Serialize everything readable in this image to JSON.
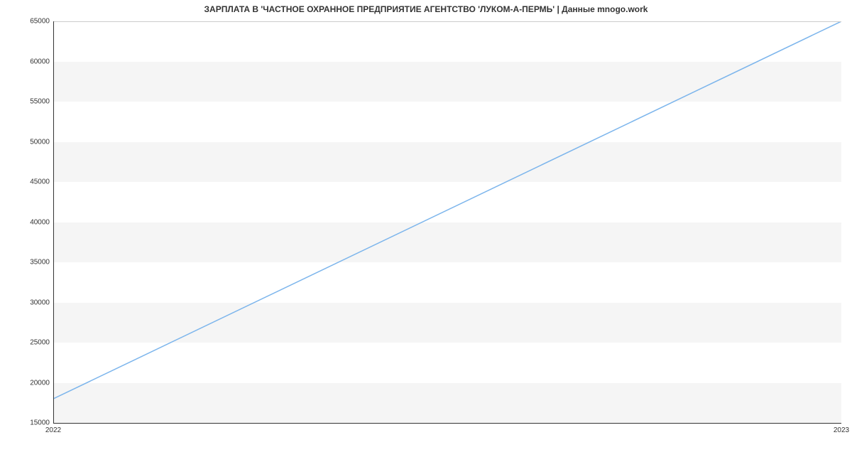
{
  "chart_data": {
    "type": "line",
    "title": "ЗАРПЛАТА В  'ЧАСТНОЕ ОХРАННОЕ ПРЕДПРИЯТИЕ АГЕНТСТВО 'ЛУКОМ-А-ПЕРМЬ' | Данные mnogo.work",
    "xlabel": "",
    "ylabel": "",
    "x": [
      2022,
      2023
    ],
    "values": [
      18000,
      65000
    ],
    "x_ticks": [
      "2022",
      "2023"
    ],
    "y_ticks": [
      15000,
      20000,
      25000,
      30000,
      35000,
      40000,
      45000,
      50000,
      55000,
      60000,
      65000
    ],
    "xlim": [
      2022,
      2023
    ],
    "ylim": [
      15000,
      65000
    ],
    "line_color": "#7cb5ec"
  }
}
